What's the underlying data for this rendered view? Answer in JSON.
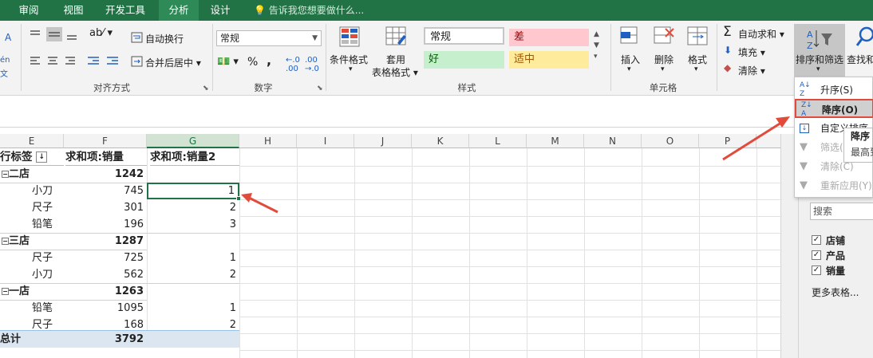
{
  "tabs": [
    "审阅",
    "视图",
    "开发工具",
    "分析",
    "设计"
  ],
  "active_tab": "分析",
  "tell_me": "告诉我您想要做什么...",
  "ribbon": {
    "wrap_text": "自动换行",
    "merge_center": "合并后居中",
    "align_group": "对齐方式",
    "number_format": "常规",
    "number_group": "数字",
    "cond_format": "条件格式",
    "table_format_1": "套用",
    "table_format_2": "表格格式",
    "styles_group": "样式",
    "style_normal": "常规",
    "style_bad": "差",
    "style_good": "好",
    "style_neutral": "适中",
    "insert": "插入",
    "delete": "删除",
    "format": "格式",
    "cells_group": "单元格",
    "autosum": "自动求和",
    "fill": "填充",
    "clear": "清除",
    "sort_filter": "排序和筛选",
    "find_select": "查找和",
    "left_a": "A",
    "left_b": "én",
    "left_c": "文"
  },
  "columns": [
    "E",
    "F",
    "G",
    "H",
    "I",
    "J",
    "K",
    "L",
    "M",
    "N",
    "O",
    "P"
  ],
  "pivot": {
    "header_row_label": "行标签",
    "header_sum1": "求和项:销量",
    "header_sum2": "求和项:销量2",
    "rows": [
      {
        "label": "二店",
        "v1": "1242",
        "v2": "",
        "group": true
      },
      {
        "label": "小刀",
        "v1": "745",
        "v2": "1",
        "group": false
      },
      {
        "label": "尺子",
        "v1": "301",
        "v2": "2",
        "group": false
      },
      {
        "label": "铅笔",
        "v1": "196",
        "v2": "3",
        "group": false
      },
      {
        "label": "三店",
        "v1": "1287",
        "v2": "",
        "group": true
      },
      {
        "label": "尺子",
        "v1": "725",
        "v2": "1",
        "group": false
      },
      {
        "label": "小刀",
        "v1": "562",
        "v2": "2",
        "group": false
      },
      {
        "label": "一店",
        "v1": "1263",
        "v2": "",
        "group": true
      },
      {
        "label": "铅笔",
        "v1": "1095",
        "v2": "1",
        "group": false
      },
      {
        "label": "尺子",
        "v1": "168",
        "v2": "2",
        "group": false
      }
    ],
    "total_label": "总计",
    "total_value": "3792"
  },
  "dropdown": {
    "asc": "升序(S)",
    "desc": "降序(O)",
    "custom": "自定义排序",
    "filter": "筛选(F)",
    "clear": "清除(C)",
    "reapply": "重新应用(Y)"
  },
  "tooltip": {
    "line1": "降序",
    "line2": "最高到"
  },
  "field_pane": {
    "search_placeholder": "搜索",
    "fields": [
      "店铺",
      "产品",
      "销量"
    ],
    "more_tables": "更多表格..."
  },
  "colors": {
    "excel_green": "#217346",
    "highlight": "#e24b3b",
    "total_band": "#dce6f1"
  }
}
